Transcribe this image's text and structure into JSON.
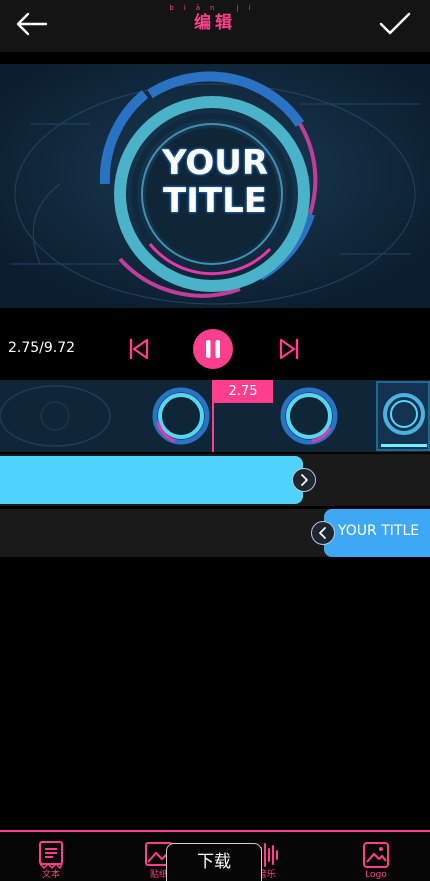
{
  "header": {
    "title": "编辑",
    "title_pinyin": "biān jí",
    "back_icon": "arrow-left-icon",
    "confirm_icon": "check-icon"
  },
  "preview": {
    "headline_line1": "YOUR",
    "headline_line2": "TITLE"
  },
  "player": {
    "time_readout": "2.75/9.72",
    "prev_icon": "skip-previous-icon",
    "pause_icon": "pause-icon",
    "next_icon": "skip-next-icon"
  },
  "timeline": {
    "playhead_label": "2.75"
  },
  "tracks": {
    "text_track_label": "YOUR TITLE"
  },
  "bottom_bar": {
    "tabs": [
      {
        "label": "文本",
        "icon": "text-document-icon"
      },
      {
        "label": "贴纸",
        "icon": "sticker-image-icon"
      },
      {
        "label": "音乐",
        "icon": "audio-wave-icon"
      },
      {
        "label": "Logo",
        "icon": "logo-image-icon"
      }
    ],
    "download_label": "下载"
  },
  "colors": {
    "accent": "#ff3f8e",
    "track_cyan": "#4fd2fb",
    "track_blue": "#3ea8f5",
    "header_bg": "#141414",
    "preview_bg": "#0d2235"
  }
}
